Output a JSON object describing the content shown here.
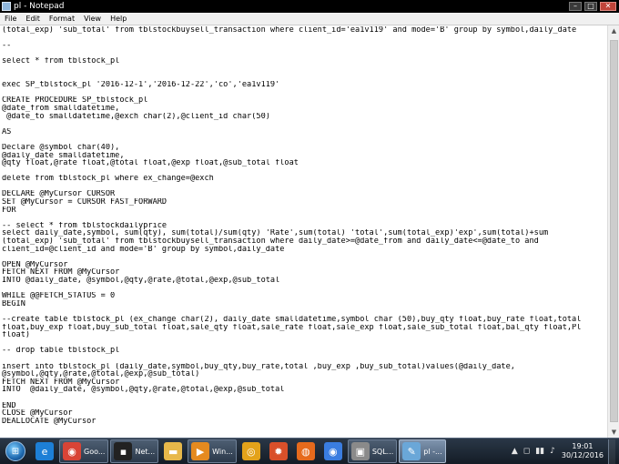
{
  "window": {
    "title": "pl - Notepad",
    "minimize_glyph": "–",
    "maximize_glyph": "□",
    "close_glyph": "✕"
  },
  "menu": {
    "items": [
      "File",
      "Edit",
      "Format",
      "View",
      "Help"
    ]
  },
  "editor": {
    "lines": [
      "(total_exp) 'sub_total' from tblstockbuysell_transaction where client_id='ea1v119' and mode='B' group by symbol,daily_date",
      "",
      "--",
      "",
      "select * from tblstock_pl",
      "",
      "",
      "exec SP_tblstock_pl '2016-12-1','2016-12-22','co','ea1v119'",
      "",
      "CREATE PROCEDURE SP_tblstock_pl",
      "@date_from smalldatetime,",
      " @date_to smalldatetime,@exch char(2),@client_id char(50)",
      "",
      "AS",
      "",
      "Declare @symbol char(40),",
      "@daily_date smalldatetime,",
      "@qty float,@rate float,@total float,@exp float,@sub_total float",
      "",
      "delete from tblstock_pl where ex_change=@exch",
      "",
      "DECLARE @MyCursor CURSOR",
      "SET @MyCursor = CURSOR FAST_FORWARD",
      "FOR",
      "",
      "-- select * from tblstockdailyprice",
      "select daily_date,symbol, sum(qty), sum(total)/sum(qty) 'Rate',sum(total) 'total',sum(total_exp)'exp',sum(total)+sum",
      "(total_exp) 'sub_total' from tblstockbuysell_transaction where daily_date>=@date_from and daily_date<=@date_to and",
      "client_id=@client_id and mode='B' group by symbol,daily_date",
      "",
      "OPEN @MyCursor",
      "FETCH NEXT FROM @MyCursor",
      "INTO @daily_date, @symbol,@qty,@rate,@total,@exp,@sub_total",
      "",
      "WHILE @@FETCH_STATUS = 0",
      "BEGIN",
      "",
      "--create table tblstock_pl (ex_change char(2), daily_date smalldatetime,symbol char (50),buy_qty float,buy_rate float,total",
      "float,buy_exp float,buy_sub_total float,sale_qty float,sale_rate float,sale_exp float,sale_sub_total float,bal_qty float,Pl",
      "float)",
      "",
      "-- drop table tblstock_pl",
      "",
      "insert into tblstock_pl (daily_date,symbol,buy_qty,buy_rate,total ,buy_exp ,buy_sub_total)values(@daily_date,",
      "@symbol,@qty,@rate,@total,@exp,@sub_total)",
      "FETCH NEXT FROM @MyCursor",
      "INTO  @daily_date, @symbol,@qty,@rate,@total,@exp,@sub_total",
      "",
      "END",
      "CLOSE @MyCursor",
      "DEALLOCATE @MyCursor"
    ]
  },
  "taskbar": {
    "start_icon": "windows-logo-icon",
    "items": [
      {
        "name": "internet-explorer",
        "label": "",
        "icon_glyph": "e",
        "color": "#1d7fd6",
        "active": false
      },
      {
        "name": "chrome-goo",
        "label": "Goo...",
        "icon_glyph": "◉",
        "color": "#d84436",
        "active": false
      },
      {
        "name": "net-window",
        "label": "Net...",
        "icon_glyph": "▪",
        "color": "#222222",
        "active": false
      },
      {
        "name": "file-explorer",
        "label": "",
        "icon_glyph": "▬",
        "color": "#e7b84a",
        "active": false
      },
      {
        "name": "media-player",
        "label": "Win...",
        "icon_glyph": "▶",
        "color": "#e58a1f",
        "active": false
      },
      {
        "name": "app-swirl",
        "label": "",
        "icon_glyph": "◎",
        "color": "#e3a21a",
        "active": false
      },
      {
        "name": "app-sun",
        "label": "",
        "icon_glyph": "✹",
        "color": "#d9502a",
        "active": false
      },
      {
        "name": "firefox",
        "label": "",
        "icon_glyph": "◍",
        "color": "#e66a1c",
        "active": false
      },
      {
        "name": "chrome",
        "label": "",
        "icon_glyph": "◉",
        "color": "#3a7de0",
        "active": false
      },
      {
        "name": "sql-server",
        "label": "SQL...",
        "icon_glyph": "▣",
        "color": "#8a8a8a",
        "active": false
      },
      {
        "name": "notepad-pl",
        "label": "pl -...",
        "icon_glyph": "✎",
        "color": "#6aa7d8",
        "active": true
      }
    ],
    "tray": {
      "chevron": "▲",
      "icons": [
        "◻",
        "▮▮",
        "♪"
      ],
      "time": "19:01",
      "date": "30/12/2016"
    }
  }
}
